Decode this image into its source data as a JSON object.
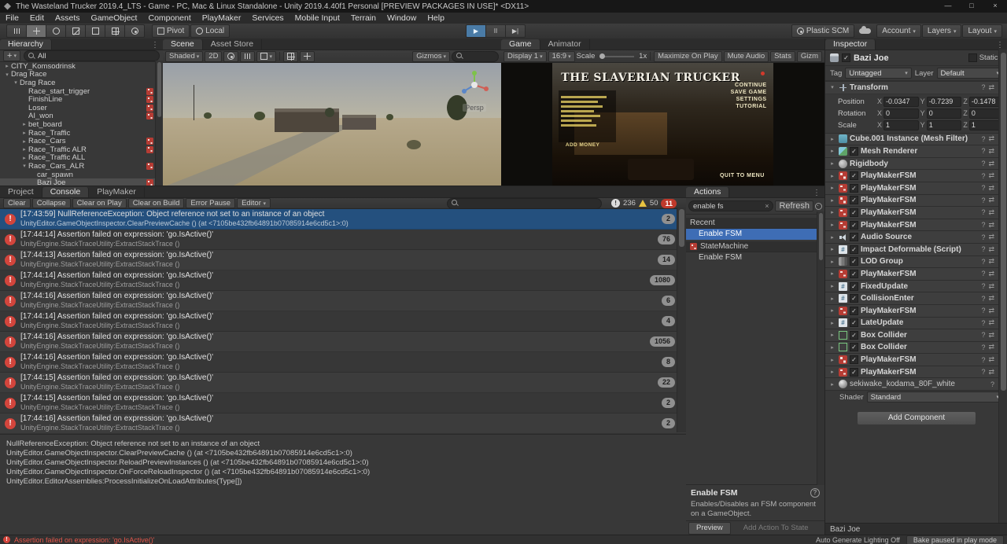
{
  "window": {
    "title": "The Wasteland Trucker 2019.4_LTS - Game - PC, Mac & Linux Standalone - Unity 2019.4.40f1 Personal [PREVIEW PACKAGES IN USE]* <DX11>",
    "buttons": {
      "minimize": "—",
      "maximize": "□",
      "close": "×"
    }
  },
  "menu_bar": [
    "File",
    "Edit",
    "Assets",
    "GameObject",
    "Component",
    "PlayMaker",
    "Services",
    "Mobile Input",
    "Terrain",
    "Window",
    "Help"
  ],
  "toolbar": {
    "pivot_label": "Pivot",
    "local_label": "Local",
    "plastic_label": "Plastic SCM",
    "account_label": "Account",
    "layers_label": "Layers",
    "layout_label": "Layout"
  },
  "hierarchy": {
    "tab": "Hierarchy",
    "create_label": "+",
    "search_text": "All",
    "items": [
      {
        "label": "CITY_Komsodrinsk",
        "depth": 0,
        "arrow": "right"
      },
      {
        "label": "Drag Race",
        "depth": 0,
        "arrow": "down"
      },
      {
        "label": "Drag Race",
        "depth": 1,
        "arrow": "down"
      },
      {
        "label": "Race_start_trigger",
        "depth": 2,
        "fsm": true
      },
      {
        "label": "FinishLine",
        "depth": 2,
        "fsm": true
      },
      {
        "label": "Loser",
        "depth": 2,
        "fsm": true
      },
      {
        "label": "AI_won",
        "depth": 2,
        "fsm": true
      },
      {
        "label": "bet_board",
        "depth": 2,
        "arrow": "right"
      },
      {
        "label": "Race_Traffic",
        "depth": 2,
        "arrow": "right"
      },
      {
        "label": "Race_Cars",
        "depth": 2,
        "arrow": "right",
        "fsm": true
      },
      {
        "label": "Race_Traffic ALR",
        "depth": 2,
        "arrow": "right",
        "fsm": true
      },
      {
        "label": "Race_Traffic ALL",
        "depth": 2,
        "arrow": "right"
      },
      {
        "label": "Race_Cars_ALR",
        "depth": 2,
        "arrow": "down",
        "fsm": true
      },
      {
        "label": "car_spawn",
        "depth": 3
      },
      {
        "label": "Bazi Joe",
        "depth": 3,
        "fsm": true,
        "selected": true
      }
    ]
  },
  "scene": {
    "tabs": [
      {
        "label": "Scene"
      },
      {
        "label": "Asset Store"
      }
    ],
    "toolbar": {
      "shaded": "Shaded",
      "mode_2d": "2D",
      "gizmos": "Gizmos"
    },
    "gizmo_label": "Persp"
  },
  "game": {
    "tabs": [
      {
        "label": "Game"
      },
      {
        "label": "Animator"
      }
    ],
    "toolbar": {
      "display": "Display 1",
      "aspect": "16:9",
      "scale_label": "Scale",
      "scale_value": "1x",
      "maximize": "Maximize On Play",
      "mute": "Mute Audio",
      "stats": "Stats",
      "gizmos": "Gizm"
    },
    "screen": {
      "title": "THE SLAVERIAN TRUCKER",
      "menu_items": [
        "CONTINUE",
        "SAVE GAME",
        "SETTINGS",
        "TUTORIAL"
      ],
      "add_money": "ADD MONEY",
      "quit": "QUIT TO MENU"
    }
  },
  "console": {
    "tabs": [
      {
        "label": "Project"
      },
      {
        "label": "Console",
        "active": true
      },
      {
        "label": "PlayMaker"
      }
    ],
    "buttons": [
      "Clear",
      "Collapse",
      "Clear on Play",
      "Clear on Build",
      "Error Pause"
    ],
    "editor_dropdown": "Editor",
    "counts": {
      "info": "236",
      "warning": "50",
      "error": "11"
    },
    "entries": [
      {
        "time": "[17:43:59]",
        "message": "NullReferenceException: Object reference not set to an instance of an object",
        "trace": "UnityEditor.GameObjectInspector.ClearPreviewCache () (at <7105be432fb64891b07085914e6cd5c1>:0)",
        "count": "2",
        "selected": true
      },
      {
        "time": "[17:44:14]",
        "message": "Assertion failed on expression: 'go.IsActive()'",
        "trace": "UnityEngine.StackTraceUtility:ExtractStackTrace ()",
        "count": "76"
      },
      {
        "time": "[17:44:13]",
        "message": "Assertion failed on expression: 'go.IsActive()'",
        "trace": "UnityEngine.StackTraceUtility:ExtractStackTrace ()",
        "count": "14"
      },
      {
        "time": "[17:44:14]",
        "message": "Assertion failed on expression: 'go.IsActive()'",
        "trace": "UnityEngine.StackTraceUtility:ExtractStackTrace ()",
        "count": "1080"
      },
      {
        "time": "[17:44:16]",
        "message": "Assertion failed on expression: 'go.IsActive()'",
        "trace": "UnityEngine.StackTraceUtility:ExtractStackTrace ()",
        "count": "6"
      },
      {
        "time": "[17:44:14]",
        "message": "Assertion failed on expression: 'go.IsActive()'",
        "trace": "UnityEngine.StackTraceUtility:ExtractStackTrace ()",
        "count": "4"
      },
      {
        "time": "[17:44:16]",
        "message": "Assertion failed on expression: 'go.IsActive()'",
        "trace": "UnityEngine.StackTraceUtility:ExtractStackTrace ()",
        "count": "1056"
      },
      {
        "time": "[17:44:16]",
        "message": "Assertion failed on expression: 'go.IsActive()'",
        "trace": "UnityEngine.StackTraceUtility:ExtractStackTrace ()",
        "count": "8"
      },
      {
        "time": "[17:44:15]",
        "message": "Assertion failed on expression: 'go.IsActive()'",
        "trace": "UnityEngine.StackTraceUtility:ExtractStackTrace ()",
        "count": "22"
      },
      {
        "time": "[17:44:15]",
        "message": "Assertion failed on expression: 'go.IsActive()'",
        "trace": "UnityEngine.StackTraceUtility:ExtractStackTrace ()",
        "count": "2"
      },
      {
        "time": "[17:44:16]",
        "message": "Assertion failed on expression: 'go.IsActive()'",
        "trace": "UnityEngine.StackTraceUtility:ExtractStackTrace ()",
        "count": "2"
      }
    ],
    "detail": [
      "NullReferenceException: Object reference not set to an instance of an object",
      "UnityEditor.GameObjectInspector.ClearPreviewCache () (at <7105be432fb64891b07085914e6cd5c1>:0)",
      "UnityEditor.GameObjectInspector.ReloadPreviewInstances () (at <7105be432fb64891b07085914e6cd5c1>:0)",
      "UnityEditor.GameObjectInspector.OnForceReloadInspector () (at <7105be432fb64891b07085914e6cd5c1>:0)",
      "UnityEditor.EditorAssemblies:ProcessInitializeOnLoadAttributes(Type[])"
    ]
  },
  "actions": {
    "title": "Actions",
    "search_value": "enable fs",
    "refresh_label": "Refresh",
    "groups": [
      {
        "header": "Recent",
        "fsm_icon": false,
        "items": [
          {
            "label": "Enable FSM",
            "selected": true
          }
        ]
      },
      {
        "header": "StateMachine",
        "fsm_icon": true,
        "items": [
          {
            "label": "Enable FSM"
          }
        ]
      }
    ],
    "detail": {
      "title": "Enable FSM",
      "description": "Enables/Disables an FSM component on a GameObject."
    },
    "preview_label": "Preview",
    "add_action_label": "Add Action To State"
  },
  "inspector": {
    "tab": "Inspector",
    "header": {
      "name": "Bazi Joe",
      "static_label": "Static"
    },
    "tag_label": "Tag",
    "tag_value": "Untagged",
    "layer_label": "Layer",
    "layer_value": "Default",
    "transform": {
      "name": "Transform",
      "rows": [
        {
          "label": "Position",
          "x": "-0.0347",
          "y": "-0.7239",
          "z": "-0.1478"
        },
        {
          "label": "Rotation",
          "x": "0",
          "y": "0",
          "z": "0"
        },
        {
          "label": "Scale",
          "x": "1",
          "y": "1",
          "z": "1"
        }
      ]
    },
    "components": [
      {
        "name": "Cube.001 Instance (Mesh Filter)",
        "icon": "mesh",
        "checkbox": false
      },
      {
        "name": "Mesh Renderer",
        "icon": "renderer",
        "checkbox": true
      },
      {
        "name": "Rigidbody",
        "icon": "rigidbody",
        "checkbox": false
      },
      {
        "name": "PlayMakerFSM",
        "icon": "fsm",
        "checkbox": true
      },
      {
        "name": "PlayMakerFSM",
        "icon": "fsm",
        "checkbox": true
      },
      {
        "name": "PlayMakerFSM",
        "icon": "fsm",
        "checkbox": true
      },
      {
        "name": "PlayMakerFSM",
        "icon": "fsm",
        "checkbox": true
      },
      {
        "name": "PlayMakerFSM",
        "icon": "fsm",
        "checkbox": true
      },
      {
        "name": "Audio Source",
        "icon": "audio",
        "checkbox": true
      },
      {
        "name": "Impact Deformable (Script)",
        "icon": "script",
        "checkbox": true
      },
      {
        "name": "LOD Group",
        "icon": "lod",
        "checkbox": true
      },
      {
        "name": "PlayMakerFSM",
        "icon": "fsm",
        "checkbox": true
      },
      {
        "name": "FixedUpdate",
        "icon": "script",
        "checkbox": true
      },
      {
        "name": "CollisionEnter",
        "icon": "script",
        "checkbox": true
      },
      {
        "name": "PlayMakerFSM",
        "icon": "fsm",
        "checkbox": true
      },
      {
        "name": "LateUpdate",
        "icon": "script",
        "checkbox": true
      },
      {
        "name": "Box Collider",
        "icon": "box",
        "checkbox": true
      },
      {
        "name": "Box Collider",
        "icon": "box",
        "checkbox": true
      },
      {
        "name": "PlayMakerFSM",
        "icon": "fsm",
        "checkbox": true
      },
      {
        "name": "PlayMakerFSM",
        "icon": "fsm",
        "checkbox": true
      }
    ],
    "material": {
      "name": "sekiwake_kodama_80F_white",
      "shader_label": "Shader",
      "shader_value": "Standard"
    },
    "add_component_label": "Add Component",
    "footer": "Bazi Joe"
  },
  "status_bar": {
    "message": "Assertion failed on expression: 'go.IsActive()'",
    "lighting": "Auto Generate Lighting Off",
    "bake": "Bake paused in play mode"
  },
  "colors": {
    "selection_blue": "#24507e",
    "action_selection": "#3e6db5",
    "error_red": "#d3453c",
    "warning_yellow": "#e8c341",
    "fsm_red": "#b63c34",
    "play_button": "#4a7ba6"
  }
}
